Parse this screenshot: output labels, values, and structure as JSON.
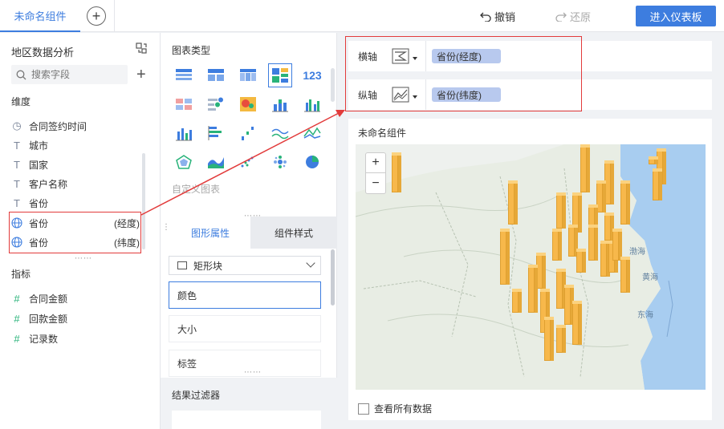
{
  "topbar": {
    "tab_title": "未命名组件",
    "add_tab_icon": "plus-circle-icon",
    "undo_label": "撤销",
    "redo_label": "还原",
    "enter_dashboard_label": "进入仪表板",
    "accent_color": "#3d7ddf"
  },
  "left_panel": {
    "title": "地区数据分析",
    "search_placeholder": "搜索字段",
    "dimensions_label": "维度",
    "dimensions": [
      {
        "icon": "clock-icon",
        "label": "合同签约时间",
        "suffix": ""
      },
      {
        "icon": "text-icon",
        "label": "城市",
        "suffix": ""
      },
      {
        "icon": "text-icon",
        "label": "国家",
        "suffix": ""
      },
      {
        "icon": "text-icon",
        "label": "客户名称",
        "suffix": ""
      },
      {
        "icon": "text-icon",
        "label": "省份",
        "suffix": ""
      },
      {
        "icon": "globe-icon",
        "label": "省份",
        "suffix": "(经度)"
      },
      {
        "icon": "globe-icon",
        "label": "省份",
        "suffix": "(纬度)"
      }
    ],
    "measures_label": "指标",
    "measures": [
      {
        "icon": "hash-icon",
        "label": "合同金额"
      },
      {
        "icon": "hash-icon",
        "label": "回款金额"
      },
      {
        "icon": "hash-icon",
        "label": "记录数"
      }
    ]
  },
  "middle_panel": {
    "chart_types_title": "图表类型",
    "custom_chart_label": "自定义图表",
    "tab_shape": "图形属性",
    "tab_style": "组件样式",
    "mark_type": "矩形块",
    "props": [
      "颜色",
      "大小",
      "标签"
    ],
    "filter_title": "结果过滤器"
  },
  "right_panel": {
    "x_axis_label": "横轴",
    "y_axis_label": "纵轴",
    "x_axis_field": "省份(经度)",
    "y_axis_field": "省份(纬度)",
    "widget_title": "未命名组件",
    "zoom_in": "+",
    "zoom_out": "−",
    "view_all_label": "查看所有数据",
    "map_labels": [
      "渤海",
      "黄海",
      "东海"
    ],
    "bar_color": "#f7b84b"
  }
}
